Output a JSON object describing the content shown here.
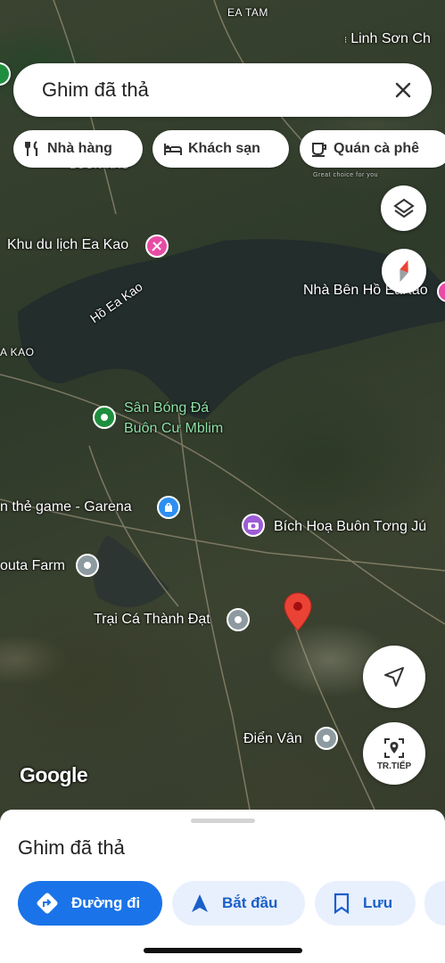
{
  "search": {
    "value": "Ghim đã thả"
  },
  "chips": [
    {
      "label": "Nhà hàng",
      "icon": "fork-knife-icon"
    },
    {
      "label": "Khách sạn",
      "icon": "bed-icon"
    },
    {
      "label": "Quán cà phê",
      "icon": "coffee-cup-icon"
    }
  ],
  "map_labels": {
    "ea_tam": "EA TAM",
    "linh_son": "Linh Sơn Ch",
    "buon_kao": "BUÔN KAO",
    "khu_du_lich": "Khu du lịch Ea Kao",
    "nha_ben_ho": "Nhà Bên Hồ EaKao",
    "ho_ea_kao": "Hồ Ea Kao",
    "a_kao": "A KAO",
    "san_bong_1": "Sân Bóng Đá",
    "san_bong_2": "Buôn Cư Mblim",
    "garena": "n thẻ game - Garena",
    "bich_hoa": "Bích Hoạ Buôn Tơng Jú",
    "outa_farm": "outa Farm",
    "trai_ca": "Trại Cá Thành Đạt",
    "dien_van": "Điển Vân",
    "google": "Google",
    "watermark_small": "Great choice for you"
  },
  "controls": {
    "streetview_label": "TR.TIẾP"
  },
  "sheet": {
    "title": "Ghim đã thả",
    "actions": [
      {
        "label": "Đường đi",
        "icon": "directions-icon"
      },
      {
        "label": "Bắt đầu",
        "icon": "navigation-arrow-icon"
      },
      {
        "label": "Lưu",
        "icon": "bookmark-icon"
      }
    ]
  },
  "colors": {
    "accent": "#1a73e8",
    "pin_red": "#ea4335",
    "poi_pink": "#e84ba4",
    "poi_purple": "#9d5bd6",
    "poi_gray": "#8d9aa0",
    "poi_green": "#1e8e3e",
    "poi_blue": "#2d8ff0"
  }
}
